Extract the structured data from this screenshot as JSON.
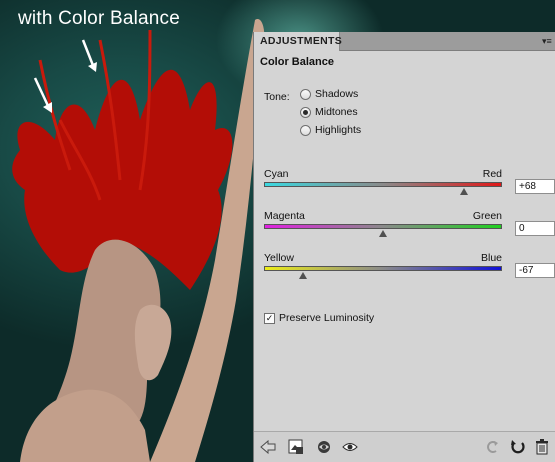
{
  "caption": "with Color Balance",
  "panel": {
    "tab_label": "ADJUSTMENTS",
    "title": "Color Balance",
    "tone": {
      "label": "Tone:",
      "options": [
        "Shadows",
        "Midtones",
        "Highlights"
      ],
      "selected": "Midtones"
    },
    "sliders": [
      {
        "left": "Cyan",
        "right": "Red",
        "value": "+68",
        "fraction": 0.84,
        "colors": [
          "#3ad8e0",
          "#e01818"
        ]
      },
      {
        "left": "Magenta",
        "right": "Green",
        "value": "0",
        "fraction": 0.5,
        "colors": [
          "#e020e0",
          "#20d020"
        ]
      },
      {
        "left": "Yellow",
        "right": "Blue",
        "value": "-67",
        "fraction": 0.165,
        "colors": [
          "#ecec18",
          "#1010d8"
        ]
      }
    ],
    "preserve_luminosity": {
      "label": "Preserve Luminosity",
      "checked": true
    }
  },
  "bottom_icons": [
    "back-arrow-icon",
    "clip-layer-icon",
    "layer-visibility-state-icon",
    "eye-icon",
    "reset-icon",
    "previous-state-icon",
    "trash-icon"
  ]
}
